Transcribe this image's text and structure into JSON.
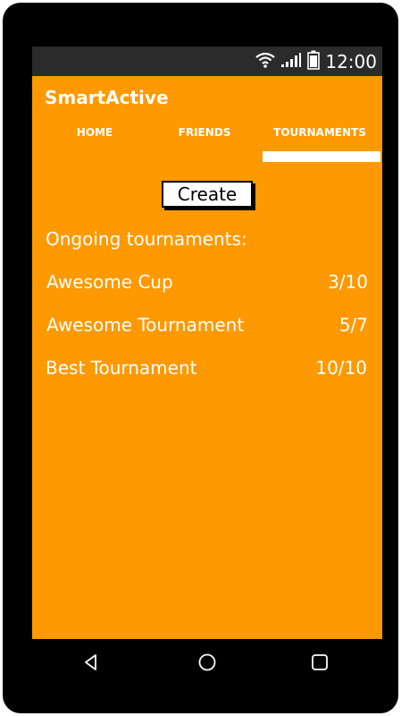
{
  "status": {
    "time": "12:00",
    "icons": [
      "wifi-icon",
      "signal-icon",
      "battery-icon"
    ]
  },
  "app": {
    "title": "SmartActive"
  },
  "tabs": [
    {
      "label": "HOME"
    },
    {
      "label": "FRIENDS"
    },
    {
      "label": "TOURNAMENTS",
      "active": true
    }
  ],
  "main": {
    "create_label": "Create",
    "section_title": "Ongoing tournaments:",
    "tournaments": [
      {
        "name": "Awesome Cup",
        "progress": "3/10"
      },
      {
        "name": "Awesome Tournament",
        "progress": "5/7"
      },
      {
        "name": "Best Tournament",
        "progress": "10/10"
      }
    ]
  },
  "nav": {
    "icons": [
      "back-icon",
      "home-icon",
      "recents-icon"
    ]
  },
  "colors": {
    "accent": "#ff9900",
    "statusbar": "#2b2b2b",
    "frame": "#000000"
  }
}
